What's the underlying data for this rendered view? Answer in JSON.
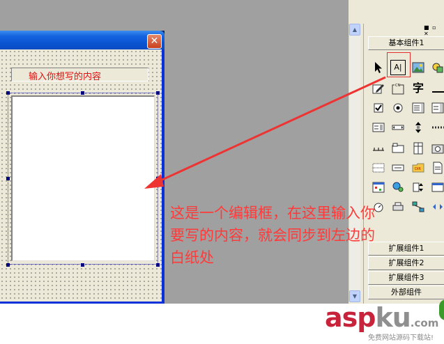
{
  "window": {
    "close_glyph": "✕",
    "label_text": "输入你想写的内容"
  },
  "toolbox": {
    "panel_controls": "■ ▫ ✕",
    "basic_components_label": "基本组件1",
    "categories": [
      "基本组件1",
      "扩展组件1",
      "扩展组件2",
      "扩展组件3",
      "外部组件"
    ],
    "tools": [
      {
        "name": "pointer-icon"
      },
      {
        "name": "text-label-icon",
        "text": "A|"
      },
      {
        "name": "picture-icon"
      },
      {
        "name": "shape-icon"
      },
      {
        "name": "edit-pen-icon"
      },
      {
        "name": "group-box-icon"
      },
      {
        "name": "char-icon",
        "text": "字"
      },
      {
        "name": "line-icon"
      },
      {
        "name": "checkbox-icon"
      },
      {
        "name": "radio-icon"
      },
      {
        "name": "listbox-icon"
      },
      {
        "name": "combobox-icon"
      },
      {
        "name": "hscroll-icon"
      },
      {
        "name": "media-icon"
      },
      {
        "name": "spin-icon"
      },
      {
        "name": "dots-icon"
      },
      {
        "name": "ruler-icon"
      },
      {
        "name": "tab-icon"
      },
      {
        "name": "grid-icon"
      },
      {
        "name": "camera-icon"
      },
      {
        "name": "table-icon"
      },
      {
        "name": "button-icon"
      },
      {
        "name": "folder-icon"
      },
      {
        "name": "doc-icon"
      },
      {
        "name": "calendar-icon"
      },
      {
        "name": "globe-user-icon"
      },
      {
        "name": "updown-icon"
      },
      {
        "name": "window-icon"
      }
    ]
  },
  "annotation": {
    "line1": "这是一个编辑框，在这里输入你",
    "line2": "要写的内容，就会同步到左边的",
    "line3": "白纸处"
  },
  "watermark": {
    "asp": "asp",
    "ku": "ku",
    "com": ".com",
    "subtitle": "免费网站源码下载站!"
  },
  "colors": {
    "workspace": "#a0a0a0",
    "title_blue": "#1463e0",
    "annotation_red": "#ff3a3a",
    "label_red": "#e01010"
  }
}
